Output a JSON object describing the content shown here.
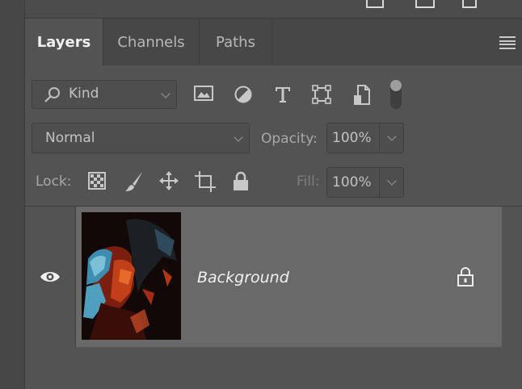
{
  "panel": {
    "tabs": [
      {
        "label": "Layers",
        "active": true
      },
      {
        "label": "Channels",
        "active": false
      },
      {
        "label": "Paths",
        "active": false
      }
    ],
    "menu_icon": "hamburger-menu-icon"
  },
  "filter": {
    "kind_label": "Kind",
    "icons": [
      "image-filter-icon",
      "adjustment-filter-icon",
      "type-filter-icon",
      "shape-filter-icon",
      "smart-object-filter-icon",
      "filter-toggle-switch"
    ]
  },
  "blend": {
    "mode_value": "Normal",
    "opacity_label": "Opacity:",
    "opacity_value": "100%"
  },
  "lock": {
    "label": "Lock:",
    "icons": [
      "lock-transparent-pixels-icon",
      "lock-image-pixels-icon",
      "lock-position-icon",
      "lock-artboard-icon",
      "lock-all-icon"
    ],
    "fill_label": "Fill:",
    "fill_value": "100%"
  },
  "layers": [
    {
      "name": "Background",
      "visible": true,
      "locked": true
    }
  ],
  "colors": {
    "panel_bg": "#535353",
    "tabbar_bg": "#474747",
    "selected_layer_bg": "#696969"
  }
}
